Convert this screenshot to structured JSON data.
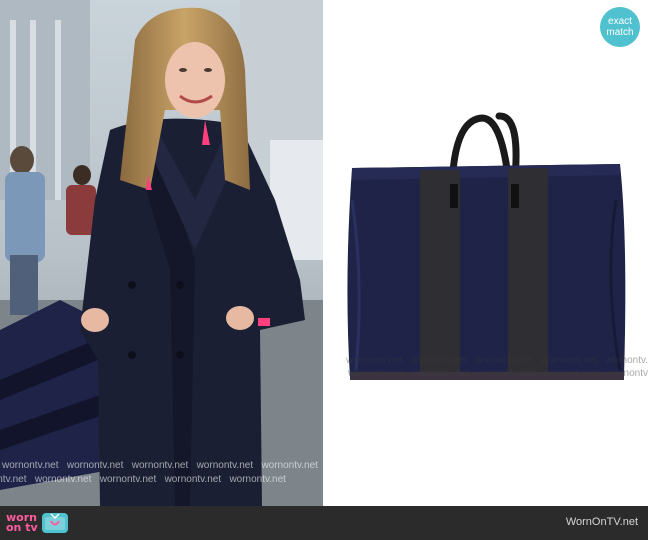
{
  "badge": {
    "line1": "exact",
    "line2": "match"
  },
  "watermark": {
    "text": "wornontv.net",
    "left_rows": [
      [
        "wornontv.net",
        "wornontv.net",
        "wornontv.net",
        "wornontv.net",
        "wornontv.net"
      ],
      [
        "wornontv.net",
        "wornontv.net",
        "wornontv.net",
        "wornontv.net",
        "wornontv.net"
      ]
    ],
    "right_rows": [
      [
        "wornontv.net",
        "wornontv.net",
        "wornontv.net",
        "wornontv.net",
        "wornontv.net"
      ],
      [
        "wornontv.net",
        "wornontv.net",
        "wornontv.net",
        "wornontv.net",
        "wornontv.net"
      ]
    ]
  },
  "footer": {
    "logo_line1": "worn",
    "logo_line2": "on tv",
    "brand": "WornOnTV.net"
  },
  "colors": {
    "badge": "#4fc1cf",
    "footer_bg": "#2b2b2b",
    "logo_pink": "#ff5b9e",
    "coat_navy": "#1b1f33",
    "bag_navy": "#1e2347"
  }
}
